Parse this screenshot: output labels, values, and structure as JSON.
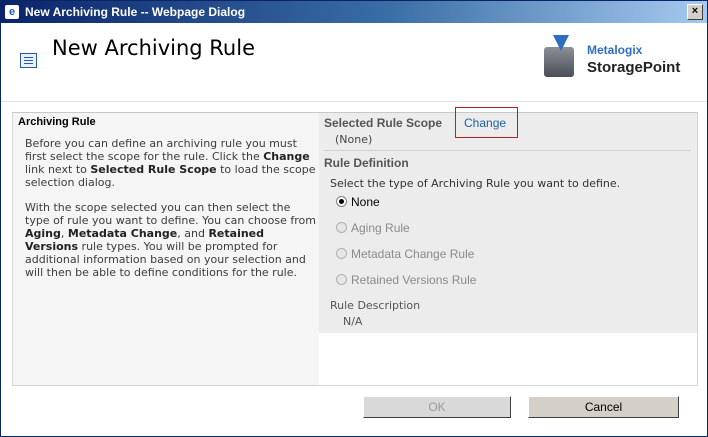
{
  "window": {
    "title": "New Archiving Rule -- Webpage Dialog",
    "close_glyph": "×"
  },
  "header": {
    "page_title": "New Archiving Rule",
    "logo_brand": "Metalogix",
    "logo_product": "StoragePoint"
  },
  "left": {
    "heading": "Archiving Rule",
    "para1": {
      "t1": "Before you can define an archiving rule you must first select the scope for the rule. Click the ",
      "b1": "Change",
      "t2": " link next to ",
      "b2": "Selected Rule Scope",
      "t3": " to load the scope selection dialog."
    },
    "para2": {
      "t1": "With the scope selected you can then select the type of rule you want to define. You can choose from ",
      "b1": "Aging",
      "t2": ", ",
      "b2": "Metadata Change",
      "t3": ", and ",
      "b3": "Retained Versions",
      "t4": " rule types. You will be prompted for additional information based on your selection and will then be able to define conditions for the rule."
    }
  },
  "right": {
    "scope_heading": "Selected Rule Scope",
    "change_link": "Change",
    "scope_value": "(None)",
    "definition_heading": "Rule Definition",
    "select_prompt": "Select the type of Archiving Rule you want to define.",
    "options": [
      {
        "label": "None",
        "checked": true,
        "enabled": true
      },
      {
        "label": "Aging Rule",
        "checked": false,
        "enabled": false
      },
      {
        "label": "Metadata Change Rule",
        "checked": false,
        "enabled": false
      },
      {
        "label": "Retained Versions Rule",
        "checked": false,
        "enabled": false
      }
    ],
    "description_label": "Rule Description",
    "description_value": "N/A"
  },
  "buttons": {
    "ok": "OK",
    "cancel": "Cancel"
  }
}
